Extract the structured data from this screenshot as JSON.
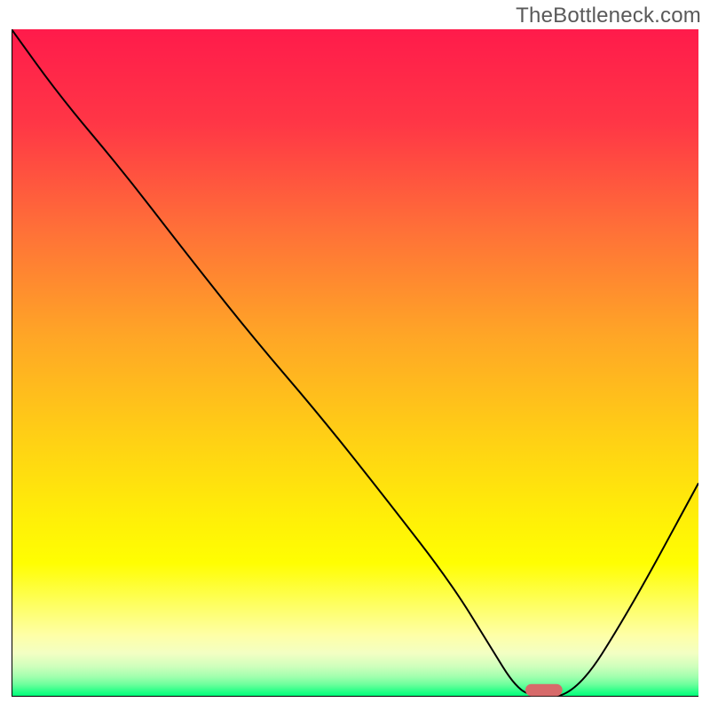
{
  "watermark": "TheBottleneck.com",
  "chart_data": {
    "type": "line",
    "title": "",
    "xlabel": "",
    "ylabel": "",
    "xlim": [
      0,
      100
    ],
    "ylim": [
      0,
      100
    ],
    "grid": false,
    "legend": false,
    "gradient_stops": [
      {
        "offset": 0.0,
        "color": "#ff1b4b"
      },
      {
        "offset": 0.14,
        "color": "#ff3646"
      },
      {
        "offset": 0.3,
        "color": "#ff7038"
      },
      {
        "offset": 0.46,
        "color": "#ffa626"
      },
      {
        "offset": 0.62,
        "color": "#ffd214"
      },
      {
        "offset": 0.74,
        "color": "#fff107"
      },
      {
        "offset": 0.8,
        "color": "#fffe02"
      },
      {
        "offset": 0.86,
        "color": "#feff5e"
      },
      {
        "offset": 0.908,
        "color": "#feffa7"
      },
      {
        "offset": 0.935,
        "color": "#f3ffc3"
      },
      {
        "offset": 0.955,
        "color": "#ceffbc"
      },
      {
        "offset": 0.97,
        "color": "#a1ffae"
      },
      {
        "offset": 0.982,
        "color": "#6bff9c"
      },
      {
        "offset": 0.994,
        "color": "#1aff82"
      },
      {
        "offset": 1.0,
        "color": "#00ff7b"
      }
    ],
    "series": [
      {
        "name": "bottleneck-curve",
        "x": [
          0,
          7,
          16,
          25,
          35,
          45,
          55,
          64,
          70,
          73,
          75.5,
          82,
          90,
          100
        ],
        "values": [
          100,
          90,
          79,
          67,
          54,
          42,
          29,
          17,
          7,
          2,
          0,
          0,
          13,
          32
        ]
      }
    ],
    "marker": {
      "name": "optimal-marker",
      "x_center": 77.5,
      "y": 0.1,
      "width": 5.4,
      "height": 1.8,
      "rx": 1.0,
      "color": "#d76a6a"
    },
    "axis": {
      "stroke": "#000000",
      "stroke_width": 2
    },
    "curve_stroke": {
      "color": "#000000",
      "width": 2
    }
  }
}
